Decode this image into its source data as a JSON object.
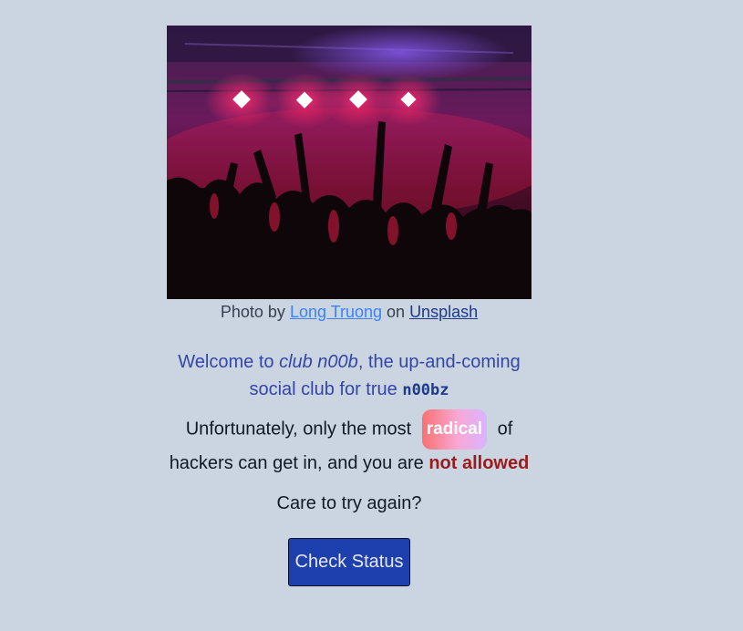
{
  "photo": {
    "alt": "Crowd of people at a concert with red and pink stage lights",
    "credit_prefix": "Photo by ",
    "author": "Long Truong",
    "credit_middle": " on ",
    "site": "Unsplash"
  },
  "welcome": {
    "prefix": "Welcome to ",
    "club_name": "club n00b",
    "middle": ", the up-and-coming social club for true ",
    "noobz": "n00bz"
  },
  "message": {
    "prefix": "Unfortunately, only the most",
    "badge": "radical",
    "middle": "of hackers can get in, and you are ",
    "status": "not allowed"
  },
  "retry_text": "Care to try again?",
  "button": {
    "label": "Check Status"
  },
  "colors": {
    "background": "#cbd5e1",
    "button": "#1e40af",
    "denied": "#991b1b",
    "welcome": "#3346a8"
  }
}
